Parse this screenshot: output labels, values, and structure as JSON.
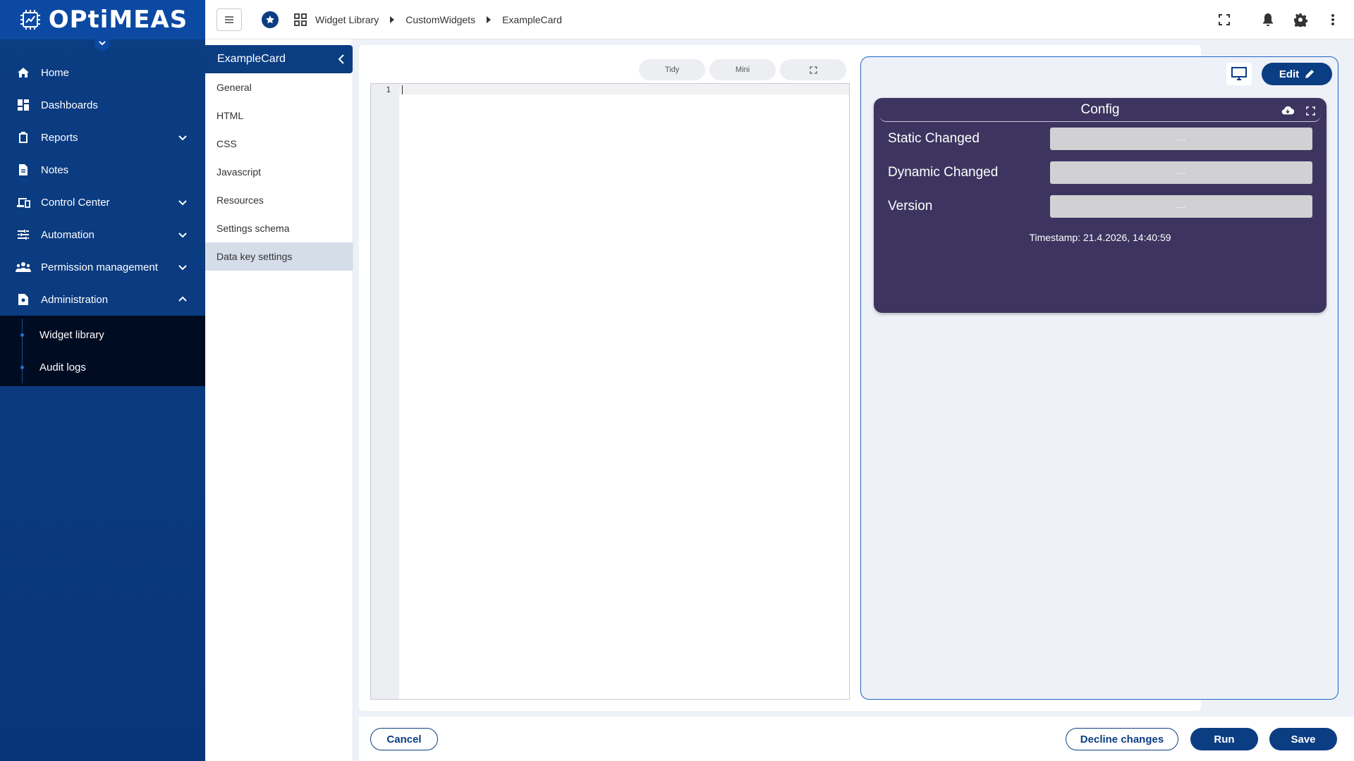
{
  "app": {
    "logo_text": "OPtiMEAS"
  },
  "nav": {
    "items": [
      {
        "label": "Home",
        "icon": "home-icon"
      },
      {
        "label": "Dashboards",
        "icon": "dashboard-icon"
      },
      {
        "label": "Reports",
        "icon": "clipboard-icon",
        "expandable": true
      },
      {
        "label": "Notes",
        "icon": "note-icon"
      },
      {
        "label": "Control Center",
        "icon": "devices-icon",
        "expandable": true
      },
      {
        "label": "Automation",
        "icon": "tune-icon",
        "expandable": true
      },
      {
        "label": "Permission management",
        "icon": "people-icon",
        "expandable": true
      },
      {
        "label": "Administration",
        "icon": "admin-icon",
        "expandable": true,
        "expanded": true
      }
    ],
    "admin_sub": [
      {
        "label": "Widget library"
      },
      {
        "label": "Audit logs"
      }
    ]
  },
  "header": {
    "breadcrumb": [
      "Widget Library",
      "CustomWidgets",
      "ExampleCard"
    ]
  },
  "subnav": {
    "title": "ExampleCard",
    "items": [
      "General",
      "HTML",
      "CSS",
      "Javascript",
      "Resources",
      "Settings schema",
      "Data key settings"
    ],
    "active": "Data key settings"
  },
  "editor": {
    "toolbar": {
      "tidy": "Tidy",
      "mini": "Mini"
    },
    "line_number": "1"
  },
  "preview": {
    "edit_label": "Edit",
    "card": {
      "title": "Config",
      "rows": [
        {
          "label": "Static Changed",
          "value": "---"
        },
        {
          "label": "Dynamic Changed",
          "value": "---"
        },
        {
          "label": "Version",
          "value": "---"
        }
      ],
      "timestamp": "Timestamp: 21.4.2026, 14:40:59"
    }
  },
  "footer": {
    "cancel": "Cancel",
    "decline": "Decline changes",
    "run": "Run",
    "save": "Save"
  },
  "colors": {
    "primary": "#0b3d83",
    "card_bg": "#3d3560",
    "preview_border": "#1e63c4"
  }
}
